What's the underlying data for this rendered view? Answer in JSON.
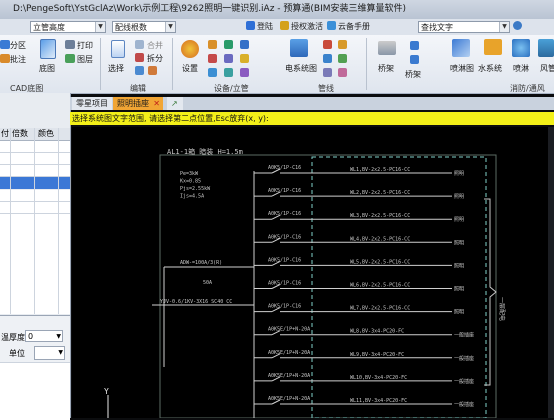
{
  "window": {
    "title": "D:\\PengeSoft\\YstGclAz\\Work\\示例工程\\9262照明一键识别.iAz - 预算通(BIM安装三维算量软件)"
  },
  "quickbar": {
    "combo1": "立管高度",
    "combo2": "配线根数",
    "btn_login": "登陆",
    "btn_activate": "授权激活",
    "btn_cloud": "云备手册",
    "search_placeholder": "查找文字"
  },
  "ribbon": {
    "partition": "分区",
    "annotate": "批注",
    "floorplan": "底图",
    "print": "打印",
    "layer": "图层",
    "select": "选择",
    "merge": "合并",
    "split": "拆分",
    "setting": "设置",
    "group_cad": "CAD底图",
    "group_edit": "编辑",
    "group_device": "设备/立管",
    "elec_diagram": "电系统图",
    "group_pipeline": "管线",
    "bridge": "桥架",
    "bridge2": "桥架",
    "fire_hydrant": "喷淋图",
    "water_system": "水系统",
    "sprinkler": "喷淋",
    "wind_pipe": "风管",
    "group_fire": "消防/通风"
  },
  "left_panel": {
    "col_scale": "倍数",
    "col_color": "颜色",
    "col_left": "付",
    "thickness_label": "温厚度",
    "thickness_value": "0",
    "unit_label": "单位"
  },
  "tabs": [
    {
      "label": "零星项目"
    },
    {
      "label": "照明插座"
    }
  ],
  "prompt": "选择系统图文字范围, 请选择第二点位置,Esc放弃(x, y):",
  "cad": {
    "box_title": "AL1-1箱 暗装 H=1.5m",
    "spec_lines": [
      "Pe=3kW",
      "Kx=0.85",
      "Pjs=2.55kW",
      "Ijs=4.5A"
    ],
    "main_breaker": "ADW-=100A/3(R)",
    "main_current": "50A",
    "incoming": "YJV-0.6/1KV-3X16 SC40 CC",
    "breakers": [
      "A0K5/1P-C16",
      "A0K5/1P-C16",
      "A0K5/1P-C16",
      "A0K5/1P-C16",
      "A0K5/1P-C16",
      "A0K5/1P-C16",
      "A0K5/1P-C16",
      "A0K5E/1P+N-20A",
      "A0K5E/1P+N-20A",
      "A0K5E/1P+N-20A",
      "A0K5E/1P+N-20A"
    ],
    "cables": [
      "WL1,BV-2x2.5-PC16-CC",
      "WL2,BV-2x2.5-PC16-CC",
      "WL3,BV-2x2.5-PC16-CC",
      "WL4,BV-2x2.5-PC16-CC",
      "WL5,BV-2x2.5-PC16-CC",
      "WL6,BV-2x2.5-PC16-CC",
      "WL7,BV-2x2.5-PC16-CC",
      "WL8,BV-3x4-PC20-FC",
      "WL9,BV-3x4-PC20-FC",
      "WL10,BV-3x4-PC20-FC",
      "WL11,BV-3x4-PC20-FC"
    ],
    "loads": [
      "照明",
      "照明",
      "照明",
      "照明",
      "照明",
      "照明",
      "照明",
      "一般插座",
      "一般插座",
      "一般插座",
      "一般插座"
    ],
    "right_label": "一层配电",
    "axis_y": "Y"
  }
}
